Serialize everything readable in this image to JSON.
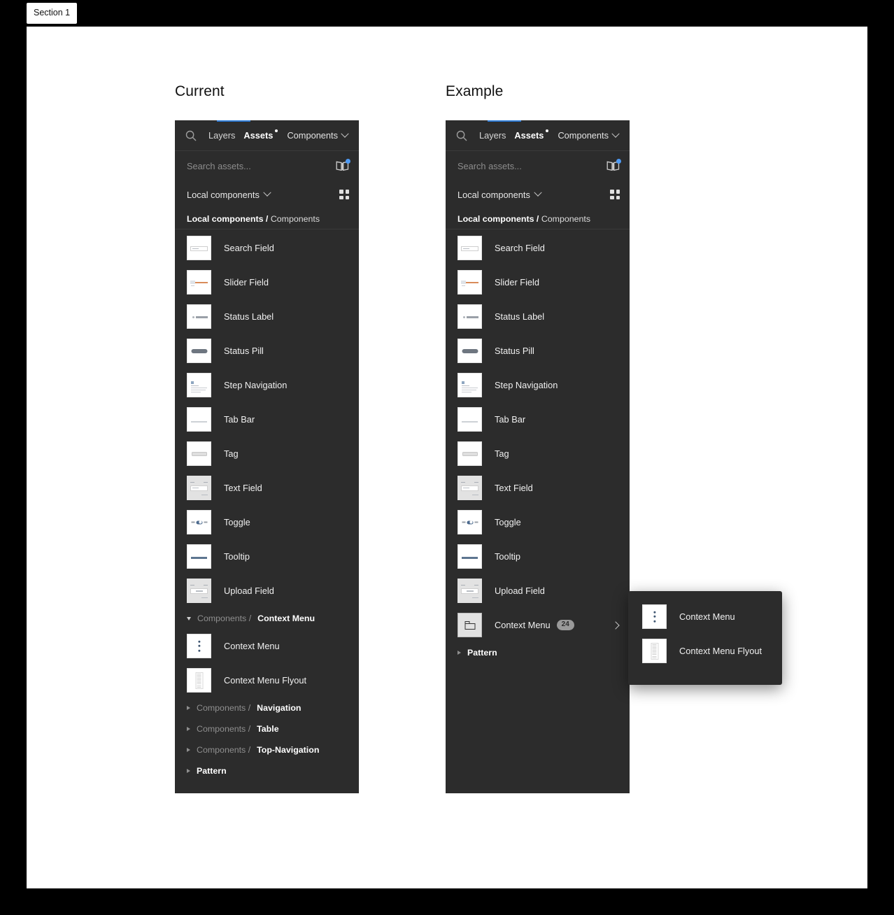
{
  "section_chip": "Section 1",
  "columns": {
    "current_title": "Current",
    "example_title": "Example"
  },
  "panel": {
    "tabs": [
      {
        "label": "Layers",
        "active": false,
        "has_dot": false
      },
      {
        "label": "Assets",
        "active": true,
        "has_dot": true
      }
    ],
    "library_dropdown": "Components",
    "search_placeholder": "Search assets...",
    "filter_label": "Local components",
    "breadcrumb": {
      "parent": "Local components /",
      "current": "Components"
    },
    "icons": {
      "search": "search-icon",
      "book": "library-book-icon",
      "grid": "grid-view-icon",
      "chevron_down": "chevron-down-icon",
      "chevron_right": "chevron-right-icon"
    }
  },
  "left_panel": {
    "assets": [
      {
        "label": "Search Field",
        "art": "search-field"
      },
      {
        "label": "Slider Field",
        "art": "slider-field"
      },
      {
        "label": "Status Label",
        "art": "status-label"
      },
      {
        "label": "Status Pill",
        "art": "status-pill"
      },
      {
        "label": "Step Navigation",
        "art": "step-nav"
      },
      {
        "label": "Tab Bar",
        "art": "tab-bar"
      },
      {
        "label": "Tag",
        "art": "tag"
      },
      {
        "label": "Text Field",
        "art": "text-field",
        "gray": true
      },
      {
        "label": "Toggle",
        "art": "toggle"
      },
      {
        "label": "Tooltip",
        "art": "tooltip"
      },
      {
        "label": "Upload Field",
        "art": "upload-field",
        "gray": true
      }
    ],
    "context_group": {
      "prefix": "Components /",
      "name": "Context Menu",
      "expanded": true,
      "children": [
        {
          "label": "Context Menu",
          "art": "dots"
        },
        {
          "label": "Context Menu Flyout",
          "art": "stack"
        }
      ]
    },
    "collapsed_groups": [
      {
        "prefix": "Components /",
        "name": "Navigation"
      },
      {
        "prefix": "Components /",
        "name": "Table"
      },
      {
        "prefix": "Components /",
        "name": "Top-Navigation"
      },
      {
        "prefix": "",
        "name": "Pattern"
      }
    ]
  },
  "right_panel": {
    "assets": [
      {
        "label": "Search Field",
        "art": "search-field"
      },
      {
        "label": "Slider Field",
        "art": "slider-field"
      },
      {
        "label": "Status Label",
        "art": "status-label"
      },
      {
        "label": "Status Pill",
        "art": "status-pill"
      },
      {
        "label": "Step Navigation",
        "art": "step-nav"
      },
      {
        "label": "Tab Bar",
        "art": "tab-bar"
      },
      {
        "label": "Tag",
        "art": "tag"
      },
      {
        "label": "Text Field",
        "art": "text-field",
        "gray": true
      },
      {
        "label": "Toggle",
        "art": "toggle"
      },
      {
        "label": "Tooltip",
        "art": "tooltip"
      },
      {
        "label": "Upload Field",
        "art": "upload-field",
        "gray": true
      }
    ],
    "folder_row": {
      "label": "Context Menu",
      "count": "24",
      "art": "folder"
    },
    "collapsed_groups": [
      {
        "prefix": "",
        "name": "Pattern"
      }
    ]
  },
  "flyout": {
    "items": [
      {
        "label": "Context Menu",
        "art": "dots"
      },
      {
        "label": "Context Menu Flyout",
        "art": "stack"
      }
    ]
  },
  "colors": {
    "panel_bg": "#2c2c2c",
    "canvas_bg": "#ffffff",
    "page_bg": "#000000",
    "accent_blue": "#2e7bd6",
    "badge_gray": "#9a9a9a",
    "library_dot": "#4f9bf5"
  }
}
